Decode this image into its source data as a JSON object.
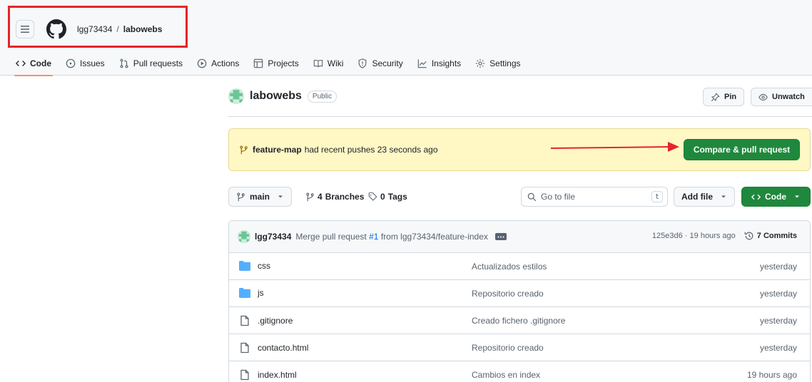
{
  "header": {
    "owner": "lgg73434",
    "separator": "/",
    "repo": "labowebs"
  },
  "nav": [
    {
      "label": "Code",
      "icon": "code-icon",
      "active": true
    },
    {
      "label": "Issues",
      "icon": "issue-icon"
    },
    {
      "label": "Pull requests",
      "icon": "pull-request-icon"
    },
    {
      "label": "Actions",
      "icon": "play-icon"
    },
    {
      "label": "Projects",
      "icon": "table-icon"
    },
    {
      "label": "Wiki",
      "icon": "book-icon"
    },
    {
      "label": "Security",
      "icon": "shield-icon"
    },
    {
      "label": "Insights",
      "icon": "graph-icon"
    },
    {
      "label": "Settings",
      "icon": "gear-icon"
    }
  ],
  "repo_header": {
    "name": "labowebs",
    "visibility": "Public",
    "pin_label": "Pin",
    "unwatch_label": "Unwatch"
  },
  "flash": {
    "branch": "feature-map",
    "message": "had recent pushes 23 seconds ago",
    "button_label": "Compare & pull request"
  },
  "toolbar": {
    "branch": "main",
    "branches_count": "4",
    "branches_label": "Branches",
    "tags_count": "0",
    "tags_label": "Tags",
    "search_placeholder": "Go to file",
    "search_shortcut": "t",
    "add_file_label": "Add file",
    "code_label": "Code"
  },
  "latest_commit": {
    "author": "lgg73434",
    "message_prefix": "Merge pull request",
    "pr": "#1",
    "message_suffix": "from lgg73434/feature-index",
    "sha": "125e3d6",
    "time": "19 hours ago",
    "commits_count": "7",
    "commits_label": "Commits"
  },
  "files": [
    {
      "name": "css",
      "type": "folder",
      "message": "Actualizados estilos",
      "date": "yesterday"
    },
    {
      "name": "js",
      "type": "folder",
      "message": "Repositorio creado",
      "date": "yesterday"
    },
    {
      "name": ".gitignore",
      "type": "file",
      "message": "Creado fichero .gitignore",
      "date": "yesterday"
    },
    {
      "name": "contacto.html",
      "type": "file",
      "message": "Repositorio creado",
      "date": "yesterday"
    },
    {
      "name": "index.html",
      "type": "file",
      "message": "Cambios en index",
      "date": "19 hours ago"
    }
  ],
  "colors": {
    "accent_green": "#1f883d",
    "flash_bg": "#fff8c5",
    "annotation_red": "#e5242a",
    "folder_blue": "#54aeff"
  }
}
